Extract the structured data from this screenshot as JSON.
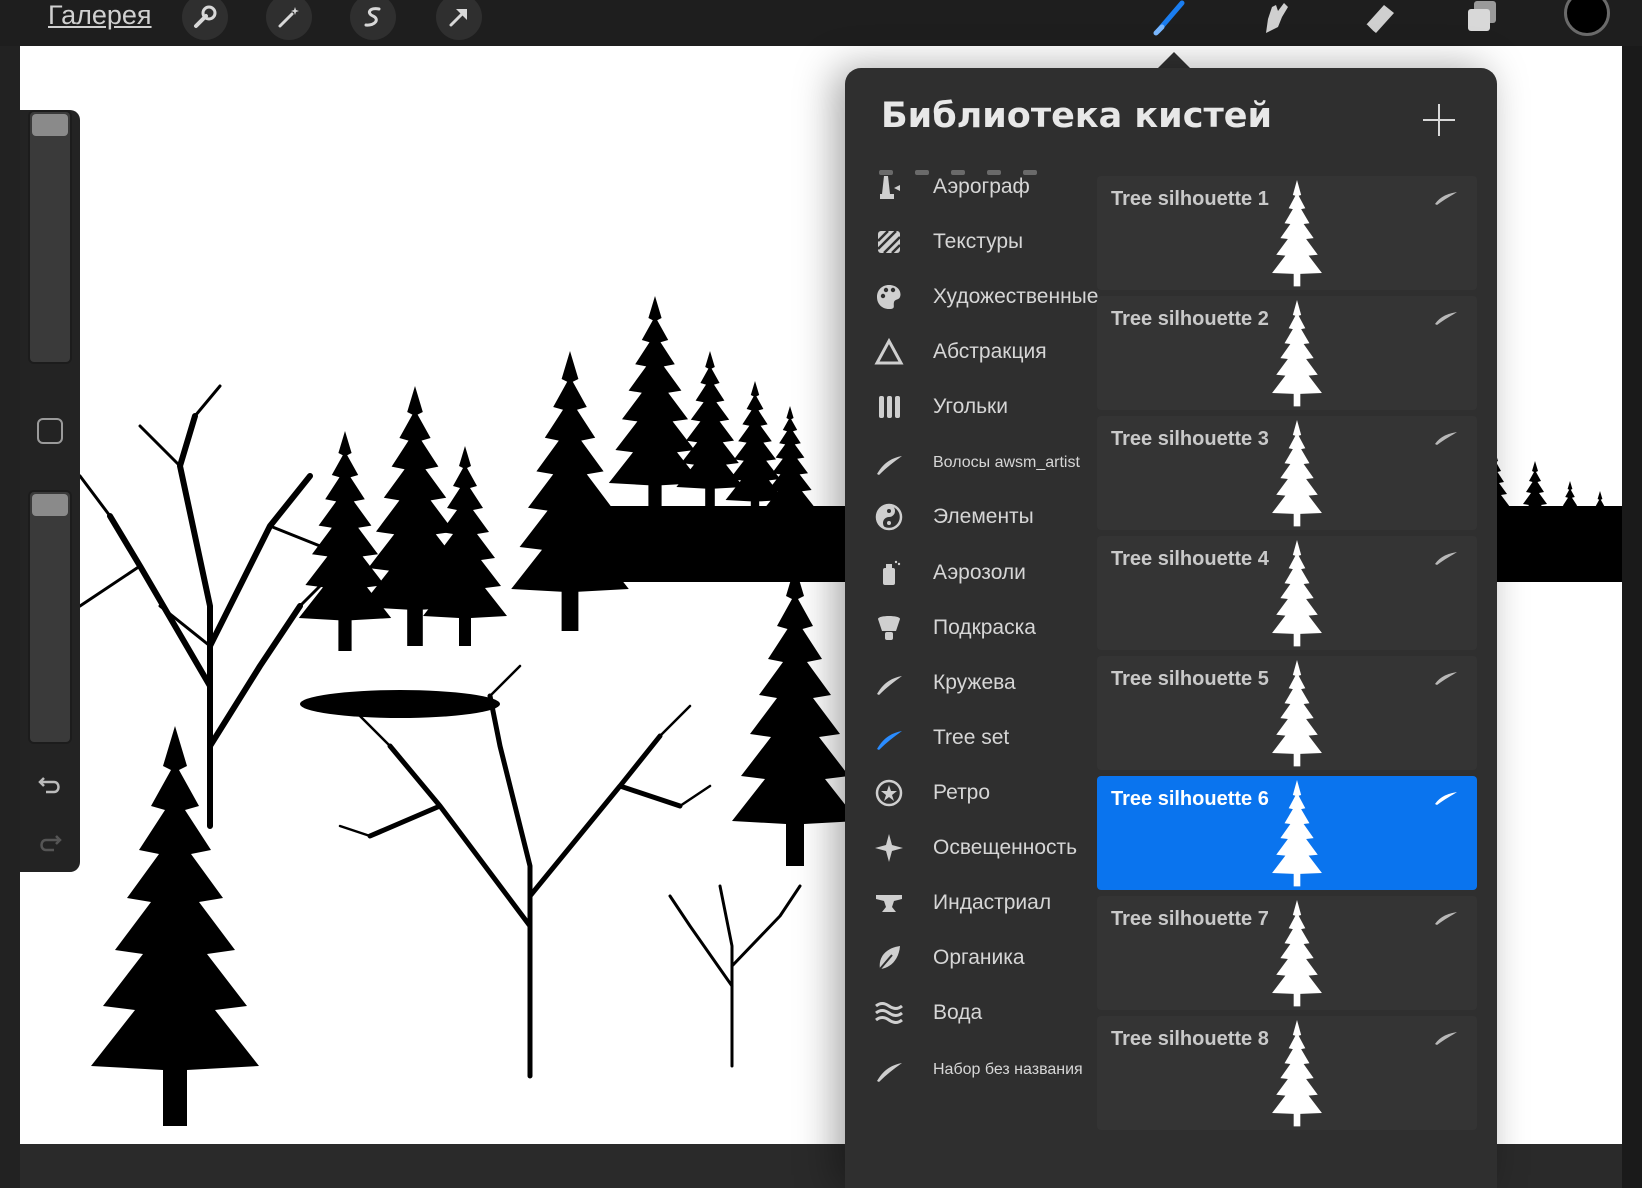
{
  "topbar": {
    "gallery_label": "Галерея",
    "tools_left": [
      "wrench-icon",
      "magic-wand-icon",
      "selection-icon",
      "transform-arrow-icon"
    ],
    "tools_right": [
      "brush-icon",
      "smudge-icon",
      "eraser-icon",
      "layers-icon"
    ],
    "active_tool": "brush-icon",
    "current_color": "#000000"
  },
  "sidebar": {
    "controls": [
      "brush-size-slider",
      "modifier-button",
      "opacity-slider",
      "undo-button",
      "redo-button"
    ]
  },
  "brush_library": {
    "title": "Библиотека кистей",
    "categories": [
      {
        "label": "Аэрограф",
        "icon": "airbrush-icon"
      },
      {
        "label": "Текстуры",
        "icon": "texture-icon"
      },
      {
        "label": "Художественные",
        "icon": "palette-icon"
      },
      {
        "label": "Абстракция",
        "icon": "triangle-icon"
      },
      {
        "label": "Угольки",
        "icon": "charcoal-icon"
      },
      {
        "label": "Волосы awsm_artist",
        "icon": "stroke-icon"
      },
      {
        "label": "Элементы",
        "icon": "yin-yang-icon"
      },
      {
        "label": "Аэрозоли",
        "icon": "spray-can-icon"
      },
      {
        "label": "Подкраска",
        "icon": "paint-icon"
      },
      {
        "label": "Кружева",
        "icon": "stroke-icon"
      },
      {
        "label": "Tree set",
        "icon": "stroke-icon"
      },
      {
        "label": "Ретро",
        "icon": "star-badge-icon"
      },
      {
        "label": "Освещенность",
        "icon": "sparkle-icon"
      },
      {
        "label": "Индастриал",
        "icon": "anvil-icon"
      },
      {
        "label": "Органика",
        "icon": "leaf-icon"
      },
      {
        "label": "Вода",
        "icon": "waves-icon"
      },
      {
        "label": "Набор без названия",
        "icon": "stroke-icon"
      }
    ],
    "selected_category": "Tree set",
    "brushes": [
      {
        "name": "Tree silhouette  1"
      },
      {
        "name": "Tree silhouette  2"
      },
      {
        "name": "Tree silhouette  3"
      },
      {
        "name": "Tree silhouette  4"
      },
      {
        "name": "Tree silhouette  5"
      },
      {
        "name": "Tree silhouette  6"
      },
      {
        "name": "Tree silhouette  7"
      },
      {
        "name": "Tree silhouette  8"
      }
    ],
    "selected_brush": "Tree silhouette  6",
    "accent_color": "#0a74ee"
  }
}
